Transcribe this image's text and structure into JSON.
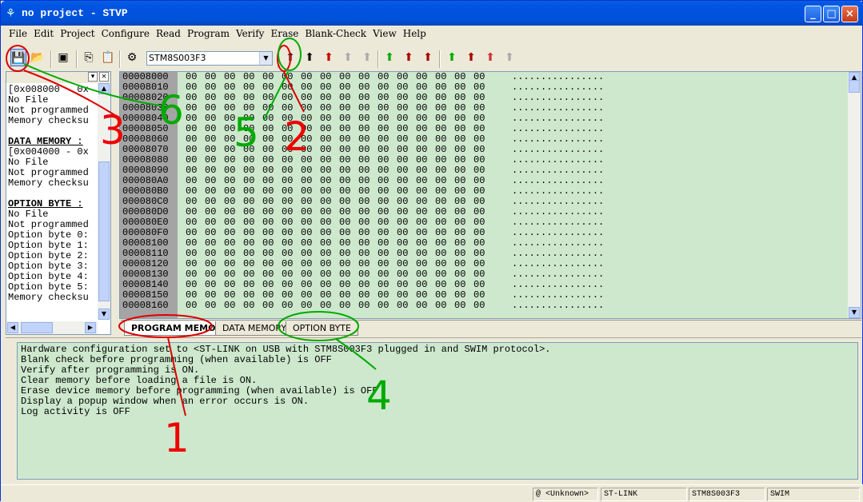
{
  "window": {
    "title": "no project - STVP"
  },
  "menu": [
    "File",
    "Edit",
    "Project",
    "Configure",
    "Read",
    "Program",
    "Verify",
    "Erase",
    "Blank-Check",
    "View",
    "Help"
  ],
  "toolbar": {
    "device": "STM8S003F3"
  },
  "left_panel": {
    "lines": [
      {
        "t": "[0x008000 - 0x",
        "b": false
      },
      {
        "t": "No File",
        "b": false
      },
      {
        "t": "Not programmed",
        "b": false
      },
      {
        "t": "Memory checksu",
        "b": false
      },
      {
        "t": "",
        "b": false
      },
      {
        "t": "DATA MEMORY :",
        "b": true
      },
      {
        "t": "[0x004000 - 0x",
        "b": false
      },
      {
        "t": "No File",
        "b": false
      },
      {
        "t": "Not programmed",
        "b": false
      },
      {
        "t": "Memory checksu",
        "b": false
      },
      {
        "t": "",
        "b": false
      },
      {
        "t": "OPTION BYTE :",
        "b": true
      },
      {
        "t": "No File",
        "b": false
      },
      {
        "t": "Not programmed",
        "b": false
      },
      {
        "t": "Option byte 0:",
        "b": false
      },
      {
        "t": "Option byte 1:",
        "b": false
      },
      {
        "t": "Option byte 2:",
        "b": false
      },
      {
        "t": "Option byte 3:",
        "b": false
      },
      {
        "t": "Option byte 4:",
        "b": false
      },
      {
        "t": "Option byte 5:",
        "b": false
      },
      {
        "t": "Memory checksu",
        "b": false
      }
    ]
  },
  "memory": {
    "addresses": [
      "00008000",
      "00008010",
      "00008020",
      "00008030",
      "00008040",
      "00008050",
      "00008060",
      "00008070",
      "00008080",
      "00008090",
      "000080A0",
      "000080B0",
      "000080C0",
      "000080D0",
      "000080E0",
      "000080F0",
      "00008100",
      "00008110",
      "00008120",
      "00008130",
      "00008140",
      "00008150",
      "00008160"
    ],
    "byte": "00",
    "ascii": "................"
  },
  "tabs": [
    "PROGRAM MEMORY",
    "DATA MEMORY",
    "OPTION BYTE"
  ],
  "log": [
    "Hardware configuration set to <ST-LINK on USB with STM8S003F3 plugged in and SWIM protocol>.",
    "Blank check before programming (when available) is OFF",
    "Verify after programming is ON.",
    "Clear memory before loading a file is ON.",
    "Erase device memory before programming (when available) is OFF",
    "Display a popup window when an error occurs is ON.",
    "Log activity is OFF"
  ],
  "status": [
    "@ <Unknown>",
    "ST-LINK",
    "STM8S003F3",
    "SWIM"
  ],
  "annotations": [
    "1",
    "2",
    "3",
    "4",
    "5",
    "6"
  ]
}
